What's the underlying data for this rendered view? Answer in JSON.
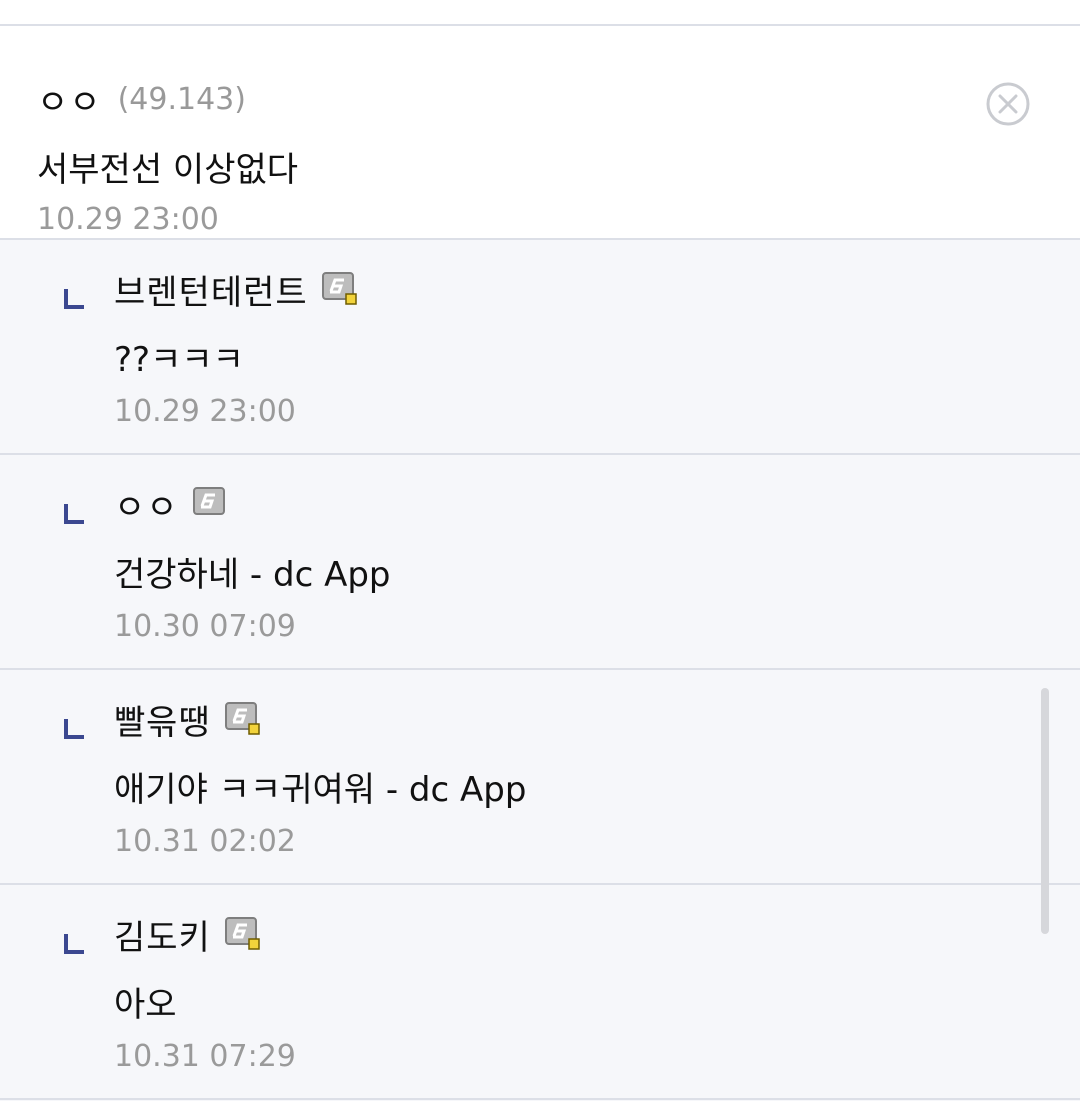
{
  "comment": {
    "author": "ㅇㅇ",
    "ip": "(49.143)",
    "content": "서부전선 이상없다",
    "time": "10.29 23:00"
  },
  "replies": [
    {
      "author": "브렌턴테런트",
      "content": "??ㅋㅋㅋ",
      "time": "10.29 23:00",
      "icon": "fixed-nick-gallery-icon"
    },
    {
      "author": "ㅇㅇ",
      "content": "건강하네 - dc App",
      "time": "10.30 07:09",
      "icon": "nick-gallery-icon"
    },
    {
      "author": "빨윾땡",
      "content": "애기야 ㅋㅋ귀여워 - dc App",
      "time": "10.31 02:02",
      "icon": "fixed-nick-gallery-icon"
    },
    {
      "author": "김도키",
      "content": "아오",
      "time": "10.31 07:29",
      "icon": "fixed-nick-gallery-icon"
    }
  ],
  "colors": {
    "background": "#f6f7fa",
    "divider": "#dcdfe7",
    "reply_arrow": "#3b4890",
    "meta_text": "#9a9a9a"
  }
}
